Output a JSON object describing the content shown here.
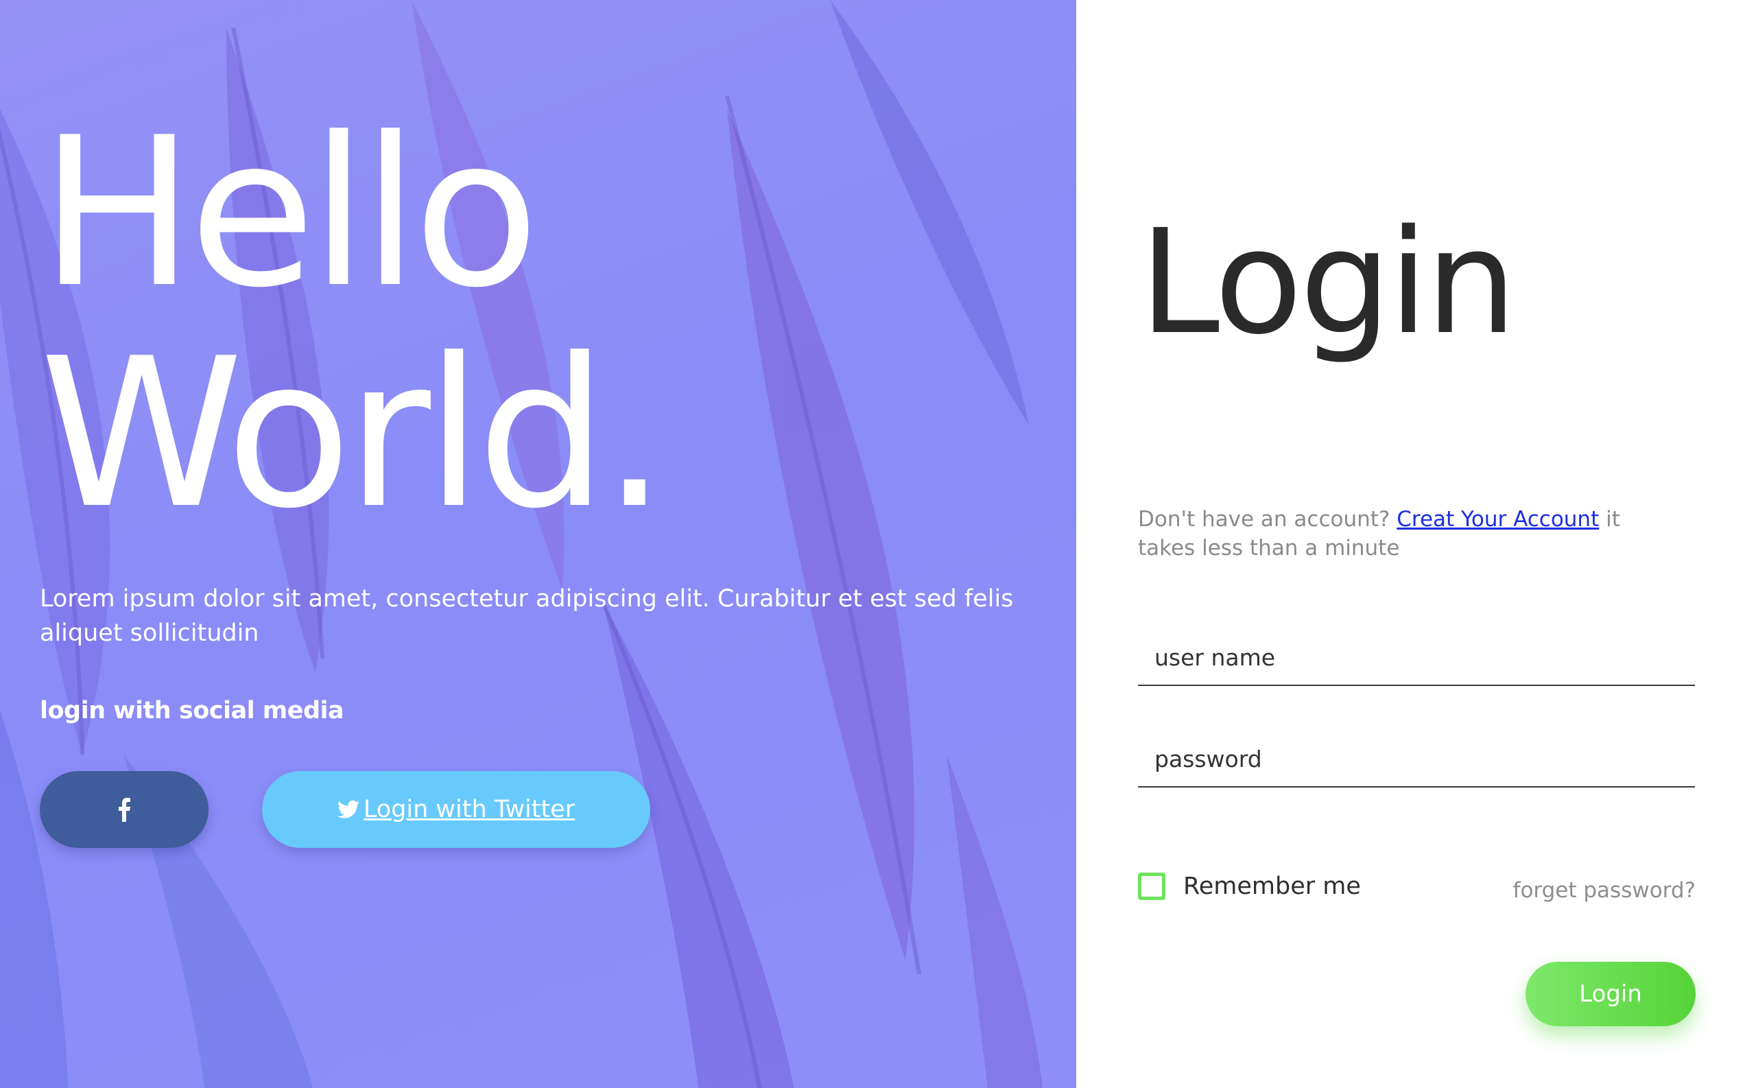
{
  "hero": {
    "title_line1": "Hello",
    "title_line2": "World.",
    "description": "Lorem ipsum dolor sit amet, consectetur adipiscing elit. Curabitur et est sed felis aliquet sollicitudin",
    "social_label": "login with social media",
    "facebook_icon": "facebook-icon",
    "twitter_icon": "twitter-icon",
    "twitter_button_label": " Login with Twitter"
  },
  "login": {
    "title": "Login",
    "signup_prefix": "Don't have an account? ",
    "signup_link": "Creat Your Account",
    "signup_suffix": " it takes less than a minute",
    "username_placeholder": "user name",
    "password_placeholder": "password",
    "remember_label": "Remember me",
    "forgot_label": "forget password?",
    "submit_label": "Login"
  },
  "colors": {
    "hero_background": "#8a8cf7",
    "facebook": "#3e5d9a",
    "twitter": "#68cafc",
    "accent_green": "#6ee35c",
    "link": "#1d2de0"
  }
}
